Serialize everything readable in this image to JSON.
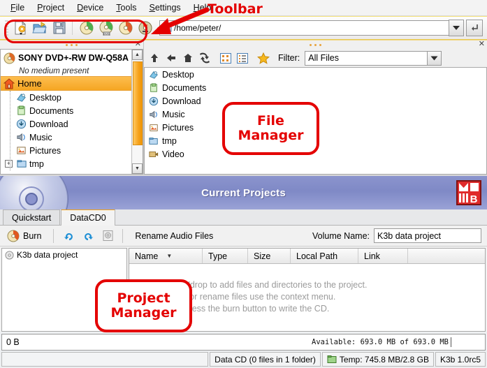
{
  "window": {
    "app_name": "K3b",
    "version_label": "K3b 1.0rc5"
  },
  "menubar": {
    "items": [
      {
        "label": "File",
        "accel": "F"
      },
      {
        "label": "Project",
        "accel": "P"
      },
      {
        "label": "Device",
        "accel": "D"
      },
      {
        "label": "Tools",
        "accel": "T"
      },
      {
        "label": "Settings",
        "accel": "S"
      },
      {
        "label": "Help",
        "accel": "H"
      }
    ]
  },
  "toolbar": {
    "buttons": [
      {
        "name": "new-project-button",
        "icon": "new-document-icon",
        "tooltip": "New Project"
      },
      {
        "name": "open-project-button",
        "icon": "open-folder-icon",
        "tooltip": "Open"
      },
      {
        "name": "save-project-button",
        "icon": "floppy-save-icon",
        "tooltip": "Save"
      },
      {
        "name": "copy-medium-button",
        "icon": "copy-disc-icon",
        "tooltip": "Copy Medium"
      },
      {
        "name": "burn-image-button",
        "icon": "burn-image-disc-icon",
        "tooltip": "Burn Image"
      },
      {
        "name": "rip-audio-button",
        "icon": "rip-audio-disc-icon",
        "tooltip": "Rip Audio CD"
      },
      {
        "name": "format-medium-button",
        "icon": "format-disc-icon",
        "tooltip": "Format Medium"
      }
    ],
    "location": {
      "value": "/home/peter/",
      "icon": "folder-small-icon",
      "dropdown_icon": "chevron-down-icon",
      "go_icon": "enter-go-icon"
    }
  },
  "device_tree": {
    "close_icon": "close-x-icon",
    "device": {
      "name": "SONY DVD+-RW DW-Q58A",
      "status": "No medium present",
      "icon": "optical-drive-icon"
    },
    "items": [
      {
        "label": "Home",
        "icon": "home-icon",
        "selected": true,
        "child": false,
        "expandable": false
      },
      {
        "label": "Desktop",
        "icon": "desktop-icon",
        "selected": false,
        "child": true,
        "expandable": false
      },
      {
        "label": "Documents",
        "icon": "documents-icon",
        "selected": false,
        "child": true,
        "expandable": false
      },
      {
        "label": "Download",
        "icon": "download-icon",
        "selected": false,
        "child": true,
        "expandable": false
      },
      {
        "label": "Music",
        "icon": "music-icon",
        "selected": false,
        "child": true,
        "expandable": false
      },
      {
        "label": "Pictures",
        "icon": "pictures-icon",
        "selected": false,
        "child": true,
        "expandable": false
      },
      {
        "label": "tmp",
        "icon": "folder-open-icon",
        "selected": false,
        "child": true,
        "expandable": true
      }
    ],
    "scroll_up_icon": "triangle-up-icon",
    "scroll_down_icon": "triangle-down-icon"
  },
  "file_browser": {
    "close_icon": "close-x-icon",
    "buttons": [
      {
        "name": "up-button",
        "icon": "arrow-up-icon"
      },
      {
        "name": "back-button",
        "icon": "arrow-left-icon"
      },
      {
        "name": "home-button",
        "icon": "home-icon"
      },
      {
        "name": "reload-button",
        "icon": "reload-icon"
      },
      {
        "name": "icon-view-button",
        "icon": "icon-view-icon"
      },
      {
        "name": "detail-view-button",
        "icon": "detail-view-icon"
      },
      {
        "name": "bookmarks-button",
        "icon": "star-icon"
      }
    ],
    "filter": {
      "label": "Filter:",
      "value": "All Files",
      "placeholder": "All Files",
      "dropdown_icon": "chevron-down-icon"
    },
    "files": [
      {
        "label": "Desktop",
        "icon": "desktop-icon"
      },
      {
        "label": "Documents",
        "icon": "documents-icon"
      },
      {
        "label": "Download",
        "icon": "download-icon"
      },
      {
        "label": "Music",
        "icon": "music-icon"
      },
      {
        "label": "Pictures",
        "icon": "pictures-icon"
      },
      {
        "label": "tmp",
        "icon": "folder-open-icon"
      },
      {
        "label": "Video",
        "icon": "video-icon"
      }
    ]
  },
  "banner": {
    "title": "Current Projects",
    "disc_icon": "cd-disc-icon",
    "logo_icon": "k3b-logo-icon",
    "gradient_start": "#8b94cd",
    "gradient_end": "#9aa2d6"
  },
  "project_tabs": [
    {
      "label": "Quickstart",
      "active": false,
      "accel": "Q"
    },
    {
      "label": "DataCD0",
      "active": true,
      "accel": "a"
    }
  ],
  "project_toolbar": {
    "burn_label": "Burn",
    "burn_icon": "burn-disc-icon",
    "buttons": [
      {
        "name": "undo-button",
        "icon": "undo-arrow-icon"
      },
      {
        "name": "redo-button",
        "icon": "redo-arrow-icon"
      },
      {
        "name": "properties-button",
        "icon": "properties-icon"
      }
    ],
    "rename_label": "Rename Audio Files",
    "volume_label": "Volume Name:",
    "volume_value": "K3b data project"
  },
  "project_tree": {
    "root_label": "K3b data project",
    "root_icon": "cd-small-icon"
  },
  "project_columns": [
    {
      "label": "Name",
      "sortable": true,
      "sort_icon": "triangle-down-icon"
    },
    {
      "label": "Type",
      "sortable": true
    },
    {
      "label": "Size",
      "sortable": true
    },
    {
      "label": "Local Path",
      "sortable": true
    },
    {
      "label": "Link",
      "sortable": true
    }
  ],
  "project_hints": [
    "Use drag'n'drop to add files and directories to the project.",
    "To remove or rename files use the context menu.",
    "After that press the burn button to write the CD."
  ],
  "size_bar": {
    "used": "0 B",
    "available": "Available: 693.0 MB of 693.0 MB"
  },
  "status_bar": {
    "left": "",
    "project_info": "Data CD (0 files in 1 folder)",
    "temp_icon": "temp-folder-icon",
    "temp_info": "Temp: 745.8 MB/2.8 GB",
    "version": "K3b 1.0rc5"
  },
  "annotations": {
    "toolbar_label": "Toolbar",
    "file_manager_line1": "File",
    "file_manager_line2": "Manager",
    "project_manager_line1": "Project",
    "project_manager_line2": "Manager",
    "color": "#e40000"
  }
}
